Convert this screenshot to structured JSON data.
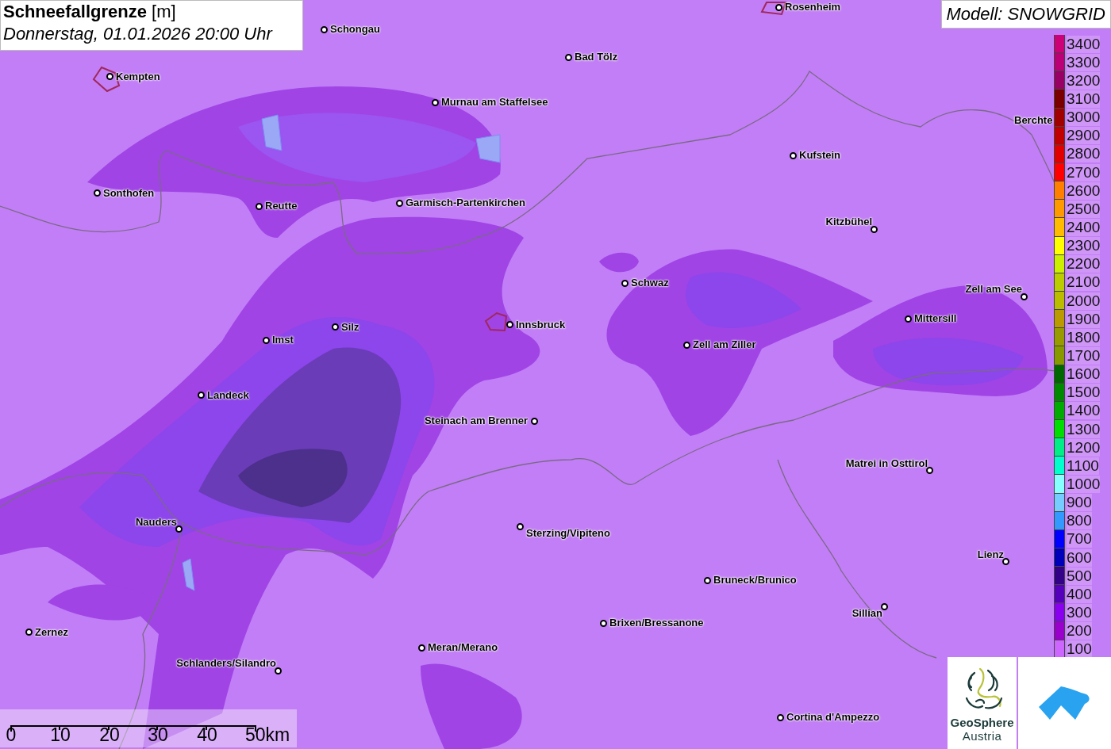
{
  "title": {
    "heading": "**Schneefallgrenze** [m]",
    "datetime": "Donnerstag, 01.01.2026 20:00 Uhr"
  },
  "model": "Modell: SNOWGRID",
  "cities": [
    {
      "name": "Rosenheim"
    },
    {
      "name": "Schongau"
    },
    {
      "name": "Kempten"
    },
    {
      "name": "Bad Tölz"
    },
    {
      "name": "Murnau am Staffelsee"
    },
    {
      "name": "Berchte"
    },
    {
      "name": "Kufstein"
    },
    {
      "name": "Sonthofen"
    },
    {
      "name": "Reutte"
    },
    {
      "name": "Garmisch-Partenkirchen"
    },
    {
      "name": "Kitzbühel"
    },
    {
      "name": "Schwaz"
    },
    {
      "name": "Zell am See"
    },
    {
      "name": "Mittersill"
    },
    {
      "name": "Innsbruck"
    },
    {
      "name": "Silz"
    },
    {
      "name": "Imst"
    },
    {
      "name": "Zell am Ziller"
    },
    {
      "name": "Landeck"
    },
    {
      "name": "Steinach am Brenner"
    },
    {
      "name": "Matrei in Osttirol"
    },
    {
      "name": "Nauders"
    },
    {
      "name": "Sterzing/Vipiteno"
    },
    {
      "name": "Lienz"
    },
    {
      "name": "Bruneck/Brunico"
    },
    {
      "name": "Sillian"
    },
    {
      "name": "Brixen/Bressanone"
    },
    {
      "name": "Zernez"
    },
    {
      "name": "Meran/Merano"
    },
    {
      "name": "Schlanders/Silandro"
    },
    {
      "name": "Cortina d'Ampezzo"
    }
  ],
  "legend": [
    {
      "label": "3400",
      "color": "#cc0077"
    },
    {
      "label": "3300",
      "color": "#bb0077"
    },
    {
      "label": "3200",
      "color": "#990066"
    },
    {
      "label": "3100",
      "color": "#7a0000"
    },
    {
      "label": "3000",
      "color": "#a00000"
    },
    {
      "label": "2900",
      "color": "#c00000"
    },
    {
      "label": "2800",
      "color": "#e00000"
    },
    {
      "label": "2700",
      "color": "#ff0000"
    },
    {
      "label": "2600",
      "color": "#ff8000"
    },
    {
      "label": "2500",
      "color": "#ff9900"
    },
    {
      "label": "2400",
      "color": "#ffbb00"
    },
    {
      "label": "2300",
      "color": "#ffff00"
    },
    {
      "label": "2200",
      "color": "#ccee00"
    },
    {
      "label": "2100",
      "color": "#bbcc00"
    },
    {
      "label": "2000",
      "color": "#bbbb00"
    },
    {
      "label": "1900",
      "color": "#bb9900"
    },
    {
      "label": "1800",
      "color": "#999900"
    },
    {
      "label": "1700",
      "color": "#889900"
    },
    {
      "label": "1600",
      "color": "#006600"
    },
    {
      "label": "1500",
      "color": "#008800"
    },
    {
      "label": "1400",
      "color": "#00aa00"
    },
    {
      "label": "1300",
      "color": "#00dd00"
    },
    {
      "label": "1200",
      "color": "#00ee88"
    },
    {
      "label": "1100",
      "color": "#00ffcc"
    },
    {
      "label": "1000",
      "color": "#88ffff"
    },
    {
      "label": "900",
      "color": "#77ccff"
    },
    {
      "label": "800",
      "color": "#3399ff"
    },
    {
      "label": "700",
      "color": "#0000ff"
    },
    {
      "label": "600",
      "color": "#0000bb"
    },
    {
      "label": "500",
      "color": "#330088"
    },
    {
      "label": "400",
      "color": "#5500bb"
    },
    {
      "label": "300",
      "color": "#8800ee"
    },
    {
      "label": "200",
      "color": "#9900cc"
    },
    {
      "label": "100",
      "color": "#cc66ff"
    }
  ],
  "scale_bar": {
    "labels": [
      "0",
      "10",
      "20",
      "30",
      "40",
      "50km"
    ]
  },
  "logo": {
    "name": "GeoSphere",
    "sub": "Austria"
  }
}
